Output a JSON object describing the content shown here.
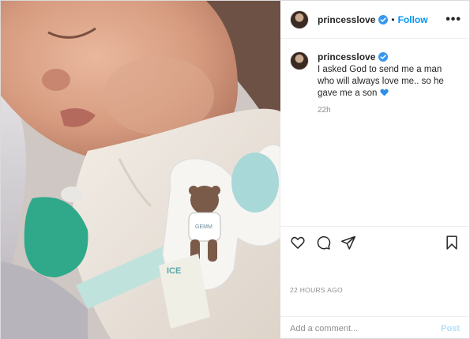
{
  "post": {
    "username": "princesslove",
    "verified": true,
    "follow_label": "Follow",
    "separator": "•",
    "more_label": "•••",
    "caption": "I asked God to send me a man who will always love me.. so he gave me a son",
    "caption_emoji": "blue-heart-emoji",
    "relative_time": "22h",
    "timestamp": "22 HOURS AGO"
  },
  "photo": {
    "sticker_text": "GEMM",
    "tag_text": "ICE"
  },
  "actions": {
    "icons": [
      "heart-icon",
      "comment-icon",
      "share-icon",
      "bookmark-icon"
    ]
  },
  "comment_box": {
    "placeholder": "Add a comment...",
    "post_label": "Post"
  },
  "colors": {
    "link": "#0095f6",
    "verified": "#3897f0",
    "post_disabled": "#b2dffc",
    "muted": "#8e8e8e"
  }
}
